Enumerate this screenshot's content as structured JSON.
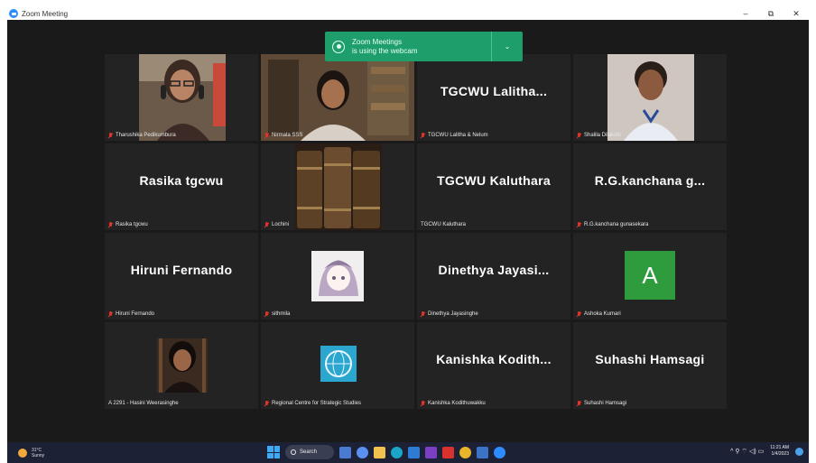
{
  "window": {
    "title": "Zoom Meeting",
    "minimize": "–",
    "restore": "⧉",
    "close": "✕"
  },
  "notification": {
    "line1": "Zoom Meetings",
    "line2": "is using the webcam",
    "chevron": "⌄"
  },
  "tiles": [
    {
      "label": "Tharushika Pedikumbura",
      "muted": true
    },
    {
      "label": "Nirmala SSS",
      "muted": true,
      "active": true
    },
    {
      "name": "TGCWU  Lalitha...",
      "label": "TGCWU Lalitha & Nelum",
      "muted": true
    },
    {
      "label": "Shalila Dilakshi",
      "muted": true
    },
    {
      "name": "Rasika  tgcwu",
      "label": "Rasika tgcwu",
      "muted": true
    },
    {
      "label": "Lochini",
      "muted": true
    },
    {
      "name": "TGCWU Kaluthara",
      "label": "TGCWU Kaluthara",
      "muted": false
    },
    {
      "name": "R.G.kanchana  g...",
      "label": "R.G.kanchana gunasekara",
      "muted": true
    },
    {
      "name": "Hiruni Fernando",
      "label": "Hiruni Fernando",
      "muted": true
    },
    {
      "label": "sithmila",
      "muted": true
    },
    {
      "name": "Dinethya  Jayasi...",
      "label": "Dinethya Jayasinghe",
      "muted": true
    },
    {
      "avatar_letter": "A",
      "label": "Ashoka Kumari",
      "muted": true
    },
    {
      "label": "A 2291 - Hasini Weerasinghe",
      "muted": false
    },
    {
      "label": "Regional Centre for Strategic Studies",
      "muted": true
    },
    {
      "name": "Kanishka  Kodith...",
      "label": "Kanishka Kodithuwakku",
      "muted": true
    },
    {
      "name": "Suhashi Hamsagi",
      "label": "Suhashi Hamsagi",
      "muted": true
    }
  ],
  "taskbar": {
    "temp": "31°C",
    "weather": "Sunny",
    "search": "Search",
    "tray": "^  ⚲  ⌔ ◁) ▭",
    "time": "11:21 AM",
    "date": "1/4/2023"
  },
  "colors": {
    "meeting_bg": "#1a1a1a",
    "tile_bg": "#232323",
    "notify_green": "#1e9e6a",
    "active_speaker": "#d6e04a",
    "avatar_green": "#2e9b3d",
    "taskbar": "#1d2136"
  }
}
